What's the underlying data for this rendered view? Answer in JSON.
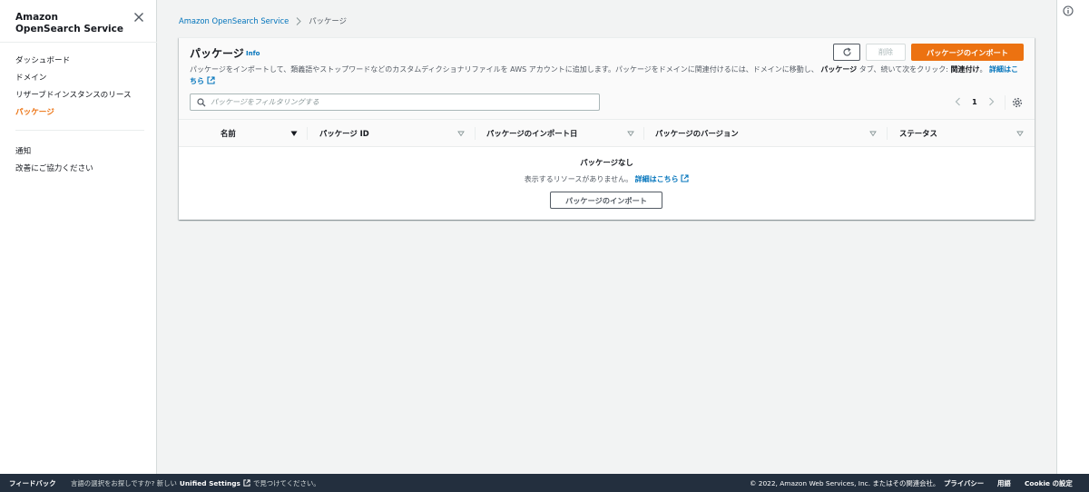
{
  "sidebar": {
    "title": "Amazon OpenSearch Service",
    "items": [
      {
        "label": "ダッシュボード"
      },
      {
        "label": "ドメイン"
      },
      {
        "label": "リザーブドインスタンスのリース"
      },
      {
        "label": "パッケージ"
      }
    ],
    "secondary": [
      {
        "label": "通知"
      },
      {
        "label": "改善にご協力ください"
      }
    ],
    "active_color": "#ec7211"
  },
  "breadcrumb": {
    "root": "Amazon OpenSearch Service",
    "current": "パッケージ"
  },
  "panel": {
    "title": "パッケージ",
    "info": "Info",
    "description_1": "パッケージをインポートして、類義語やストップワードなどのカスタムディクショナリファイルを AWS アカウントに追加します。パッケージをドメインに関連付けるには、ドメインに移動し、",
    "description_bold_1": "パッケージ",
    "description_2": "タブ、続いて次をクリック: ",
    "description_bold_2": "関連付け",
    "description_3": "。",
    "description_link": "詳細はこちら",
    "delete_label": "削除",
    "import_label": "パッケージのインポート",
    "filter_placeholder": "パッケージをフィルタリングする",
    "page": "1"
  },
  "table": {
    "columns": [
      "名前",
      "パッケージ ID",
      "パッケージのインポート日",
      "パッケージのバージョン",
      "ステータス"
    ]
  },
  "empty": {
    "title": "パッケージなし",
    "description": "表示するリソースがありません。",
    "link": "詳細はこちら",
    "button": "パッケージのインポート"
  },
  "footer": {
    "feedback": "フィードバック",
    "msg_1": "言語の選択をお探しですか? 新しい",
    "msg_bold": "Unified Settings",
    "msg_2": "で見つけてください。",
    "copyright": "© 2022, Amazon Web Services, Inc. またはその関連会社。",
    "privacy": "プライバシー",
    "terms": "用語",
    "cookie": "Cookie の設定"
  },
  "colors": {
    "accent": "#ec7211",
    "link": "#0073bb",
    "footer_bg": "#232f3e"
  }
}
